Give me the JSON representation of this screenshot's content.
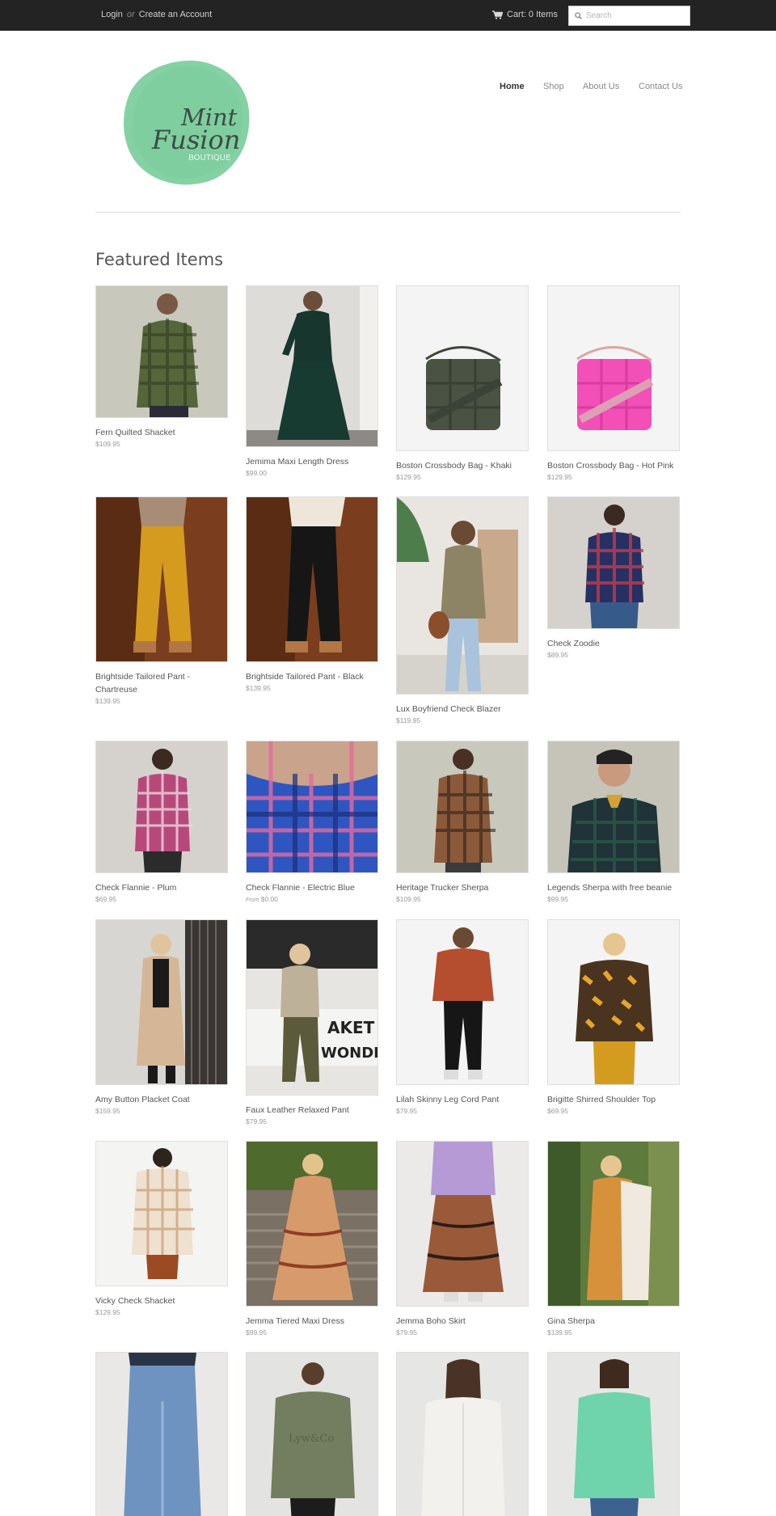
{
  "topbar": {
    "login": "Login",
    "or": "or",
    "create_account": "Create an Account",
    "cart": "Cart: 0 Items",
    "search_placeholder": "Search"
  },
  "brand": {
    "line1": "Mint",
    "line2": "Fusion",
    "line3": "BOUTIQUE",
    "accent": "#7dcf9d"
  },
  "nav": {
    "items": [
      "Home",
      "Shop",
      "About Us",
      "Contact Us"
    ]
  },
  "featured": {
    "title": "Featured Items",
    "items": [
      {
        "name": "Fern Quilted Shacket",
        "price": "$109.95"
      },
      {
        "name": "Jemima Maxi Length Dress",
        "price": "$99.00"
      },
      {
        "name": "Boston Crossbody Bag - Khaki",
        "price": "$129.95"
      },
      {
        "name": "Boston Crossbody Bag - Hot Pink",
        "price": "$129.95"
      },
      {
        "name": "Brightside Tailored Pant - Chartreuse",
        "price": "$139.95"
      },
      {
        "name": "Brightside Tailored Pant - Black",
        "price": "$139.95"
      },
      {
        "name": "Lux Boyfriend Check Blazer",
        "price": "$119.95"
      },
      {
        "name": "Check Zoodie",
        "price": "$89.95"
      },
      {
        "name": "Check Flannie - Plum",
        "price": "$69.95"
      },
      {
        "name": "Check Flannie - Electric Blue",
        "price_prefix": "From",
        "price": "$0.00"
      },
      {
        "name": "Heritage Trucker Sherpa",
        "price": "$109.95"
      },
      {
        "name": "Legends Sherpa with free beanie",
        "price": "$99.95"
      },
      {
        "name": "Amy Button Placket Coat",
        "price": "$159.95"
      },
      {
        "name": "Faux Leather Relaxed Pant",
        "price": "$79.95"
      },
      {
        "name": "Lilah Skinny Leg Cord Pant",
        "price": "$79.95"
      },
      {
        "name": "Brigitte Shirred Shoulder Top",
        "price": "$69.95"
      },
      {
        "name": "Vicky Check Shacket",
        "price": "$129.95"
      },
      {
        "name": "Jemma Tiered Maxi Dress",
        "price": "$99.95"
      },
      {
        "name": "Jemma Boho Skirt",
        "price": "$79.95"
      },
      {
        "name": "Gina Sherpa",
        "price": "$139.95"
      },
      {
        "name": "",
        "price": ""
      },
      {
        "name": "",
        "price": "",
        "print_text": "Lyw&Co"
      },
      {
        "name": "",
        "price": ""
      },
      {
        "name": "",
        "price": ""
      }
    ]
  }
}
